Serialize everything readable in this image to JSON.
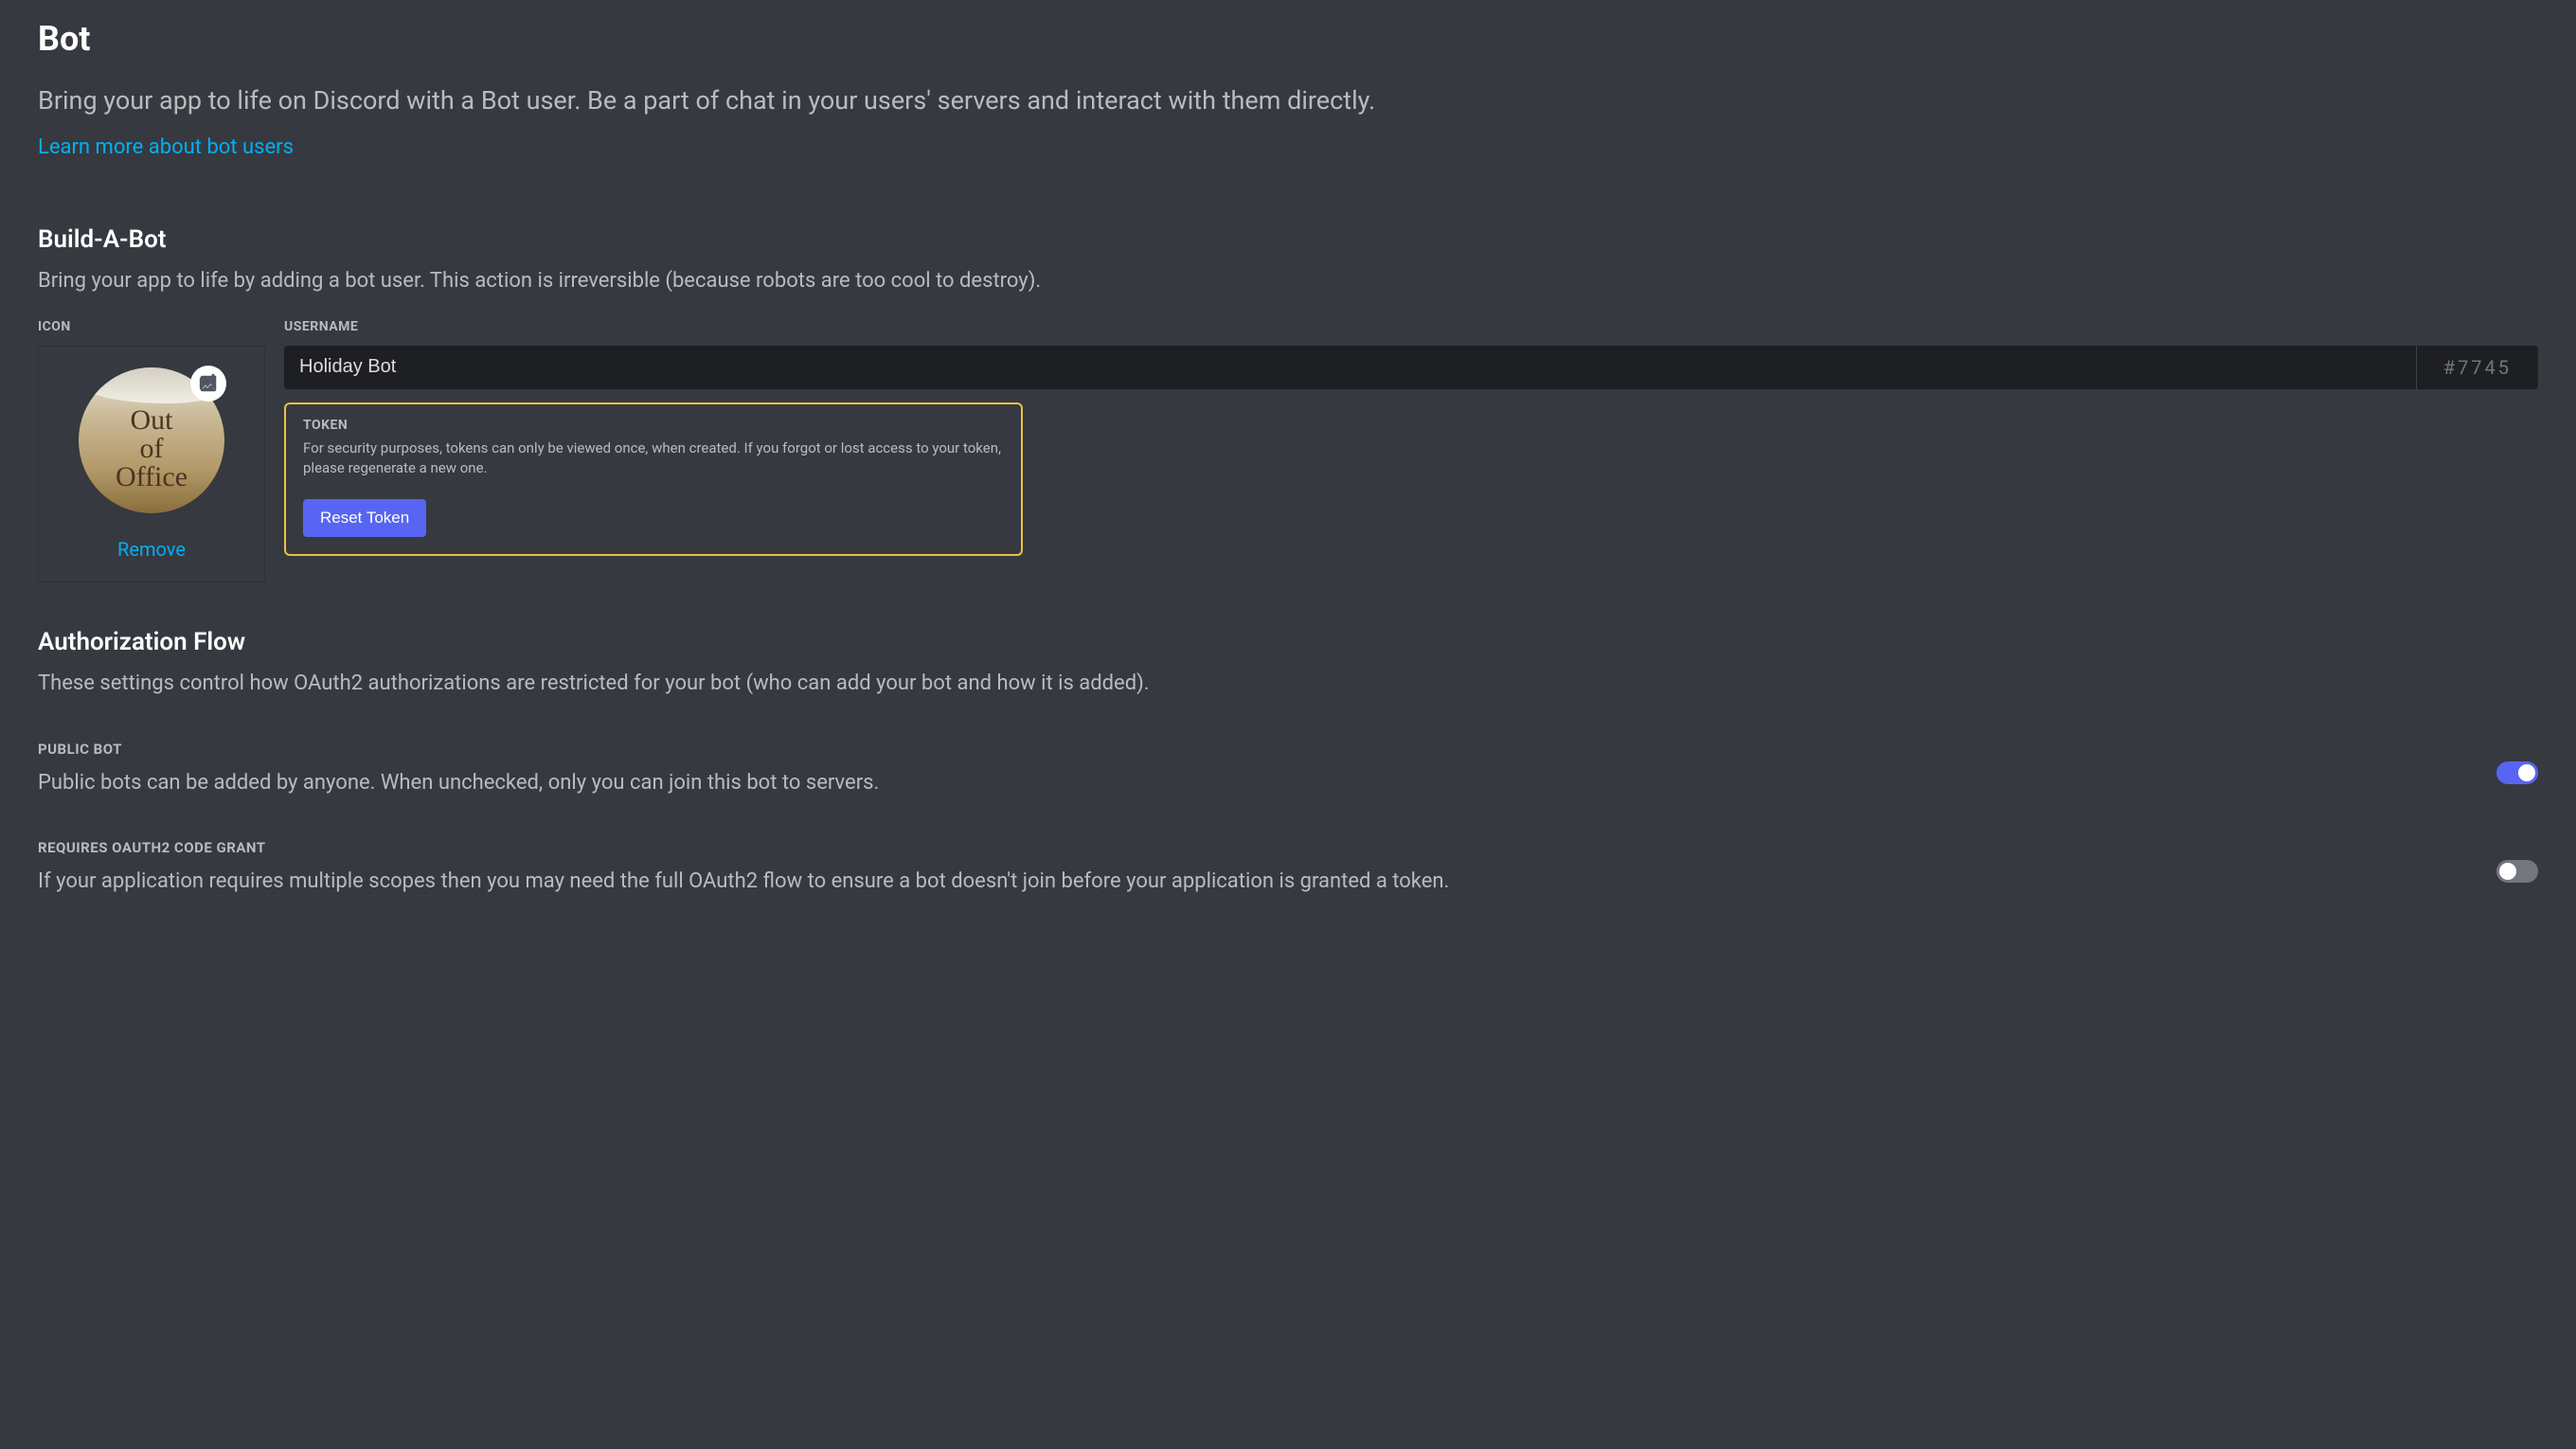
{
  "header": {
    "title": "Bot",
    "description": "Bring your app to life on Discord with a Bot user. Be a part of chat in your users' servers and interact with them directly.",
    "learn_more": "Learn more about bot users"
  },
  "build_a_bot": {
    "title": "Build-A-Bot",
    "description": "Bring your app to life by adding a bot user. This action is irreversible (because robots are too cool to destroy).",
    "icon_label": "ICON",
    "avatar_text_line1": "Out of",
    "avatar_text_line2": "Office",
    "remove_label": "Remove",
    "username_label": "USERNAME",
    "username_value": "Holiday Bot",
    "discriminator": "#7745",
    "token": {
      "label": "TOKEN",
      "description": "For security purposes, tokens can only be viewed once, when created. If you forgot or lost access to your token, please regenerate a new one.",
      "reset_button": "Reset Token"
    }
  },
  "auth_flow": {
    "title": "Authorization Flow",
    "description": "These settings control how OAuth2 authorizations are restricted for your bot (who can add your bot and how it is added)."
  },
  "toggles": {
    "public_bot": {
      "label": "PUBLIC BOT",
      "description": "Public bots can be added by anyone. When unchecked, only you can join this bot to servers.",
      "enabled": true
    },
    "oauth2_grant": {
      "label": "REQUIRES OAUTH2 CODE GRANT",
      "description": "If your application requires multiple scopes then you may need the full OAuth2 flow to ensure a bot doesn't join before your application is granted a token.",
      "enabled": false
    }
  }
}
